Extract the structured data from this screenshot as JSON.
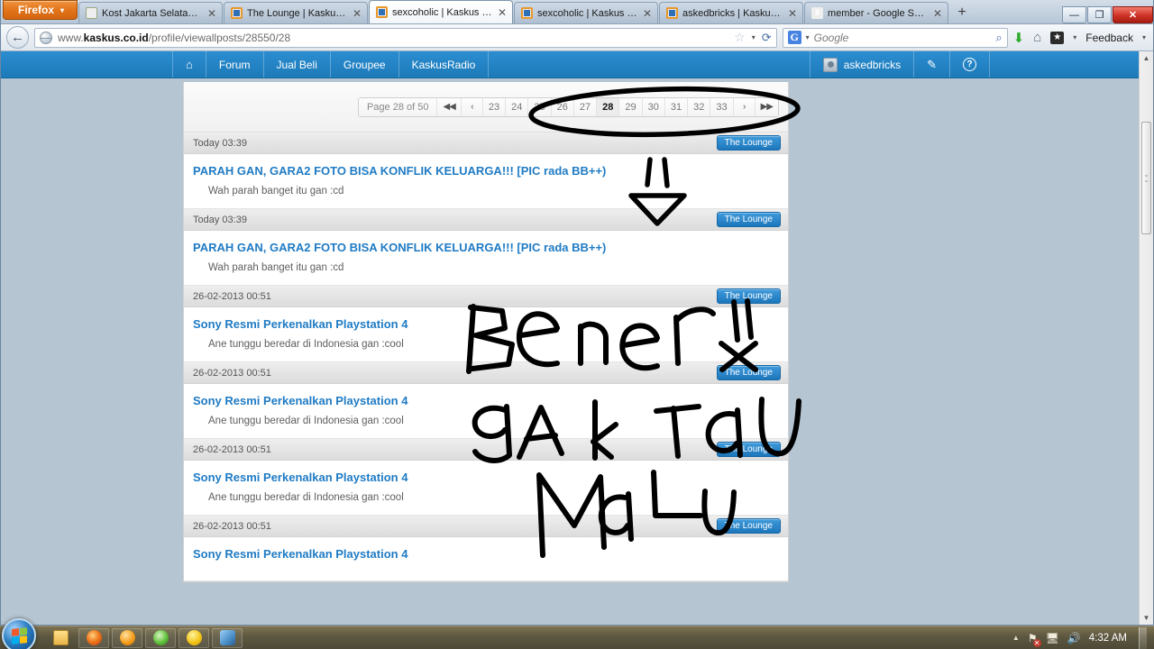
{
  "browser": {
    "app_button": "Firefox",
    "tabs": [
      {
        "title": "Kost Jakarta Selatan TB Si...",
        "favicon": "kost-favicon",
        "active": false
      },
      {
        "title": "The Lounge | Kaskus - Th...",
        "favicon": "kaskus-favicon",
        "active": false
      },
      {
        "title": "sexcoholic | Kaskus - The...",
        "favicon": "kaskus-favicon",
        "active": true
      },
      {
        "title": "sexcoholic | Kaskus - The...",
        "favicon": "kaskus-favicon",
        "active": false
      },
      {
        "title": "askedbricks | Kaskus - Th...",
        "favicon": "kaskus-favicon",
        "active": false
      },
      {
        "title": "member - Google Search",
        "favicon": "google-favicon",
        "active": false
      }
    ],
    "new_tab_label": "+",
    "window_controls": {
      "minimize": "—",
      "restore": "❐",
      "close": "✕"
    },
    "back_icon": "←",
    "url_domain": "kaskus.co.id",
    "url_prefix": "www.",
    "url_path": "/profile/viewallposts/28550/28",
    "url_full": "www.kaskus.co.id/profile/viewallposts/28550/28",
    "star_icon": "☆",
    "dropdown_icon": "▾",
    "reload_icon": "⟳",
    "search_engine": "G",
    "search_placeholder": "Google",
    "search_value": "",
    "magnifier_icon": "⌕",
    "download_icon": "⬇",
    "home_icon": "⌂",
    "bookmark_icon": "★",
    "feedback_label": "Feedback"
  },
  "site": {
    "nav_left": [
      {
        "label": "",
        "icon": "home-icon"
      },
      {
        "label": "Forum"
      },
      {
        "label": "Jual Beli"
      },
      {
        "label": "Groupee"
      },
      {
        "label": "KaskusRadio"
      }
    ],
    "username": "askedbricks",
    "edit_icon": "✎",
    "help_icon": "?"
  },
  "pagination": {
    "label": "Page 28 of 50",
    "first_icon": "⏮",
    "prev_icon": "‹",
    "next_icon": "›",
    "last_icon": "⏭",
    "pages": [
      "23",
      "24",
      "25",
      "26",
      "27",
      "28",
      "29",
      "30",
      "31",
      "32",
      "33"
    ],
    "current": "28"
  },
  "posts": [
    {
      "date": "Today 03:39",
      "forum": "The Lounge",
      "title": "PARAH GAN, GARA2 FOTO BISA KONFLIK KELUARGA!!! [PIC rada BB++)",
      "snippet": "Wah parah banget itu gan :cd"
    },
    {
      "date": "Today 03:39",
      "forum": "The Lounge",
      "title": "PARAH GAN, GARA2 FOTO BISA KONFLIK KELUARGA!!! [PIC rada BB++)",
      "snippet": "Wah parah banget itu gan :cd"
    },
    {
      "date": "26-02-2013 00:51",
      "forum": "The Lounge",
      "title": "Sony Resmi Perkenalkan Playstation 4",
      "snippet": "Ane tunggu beredar di Indonesia gan :cool"
    },
    {
      "date": "26-02-2013 00:51",
      "forum": "The Lounge",
      "title": "Sony Resmi Perkenalkan Playstation 4",
      "snippet": "Ane tunggu beredar di Indonesia gan :cool"
    },
    {
      "date": "26-02-2013 00:51",
      "forum": "The Lounge",
      "title": "Sony Resmi Perkenalkan Playstation 4",
      "snippet": "Ane tunggu beredar di Indonesia gan :cool"
    },
    {
      "date": "26-02-2013 00:51",
      "forum": "The Lounge",
      "title": "Sony Resmi Perkenalkan Playstation 4",
      "snippet": ""
    }
  ],
  "annotations": {
    "line1": "BeNer!!",
    "line2": "gAk TaU",
    "line3": "MaLu",
    "ellipse_target": "pagination",
    "arrow_target": "first-post",
    "ink_color": "#000000"
  },
  "taskbar": {
    "start_label": "Start",
    "items": [
      {
        "name": "file-explorer"
      },
      {
        "name": "firefox"
      },
      {
        "name": "opera"
      },
      {
        "name": "media-player"
      },
      {
        "name": "yahoo-messenger"
      },
      {
        "name": "paint"
      }
    ],
    "tray": {
      "expand_icon": "▲",
      "network_icon": "network-error-icon",
      "monitor_icon": "monitor-icon",
      "volume_icon": "🔊",
      "clock": "4:32 AM"
    }
  }
}
